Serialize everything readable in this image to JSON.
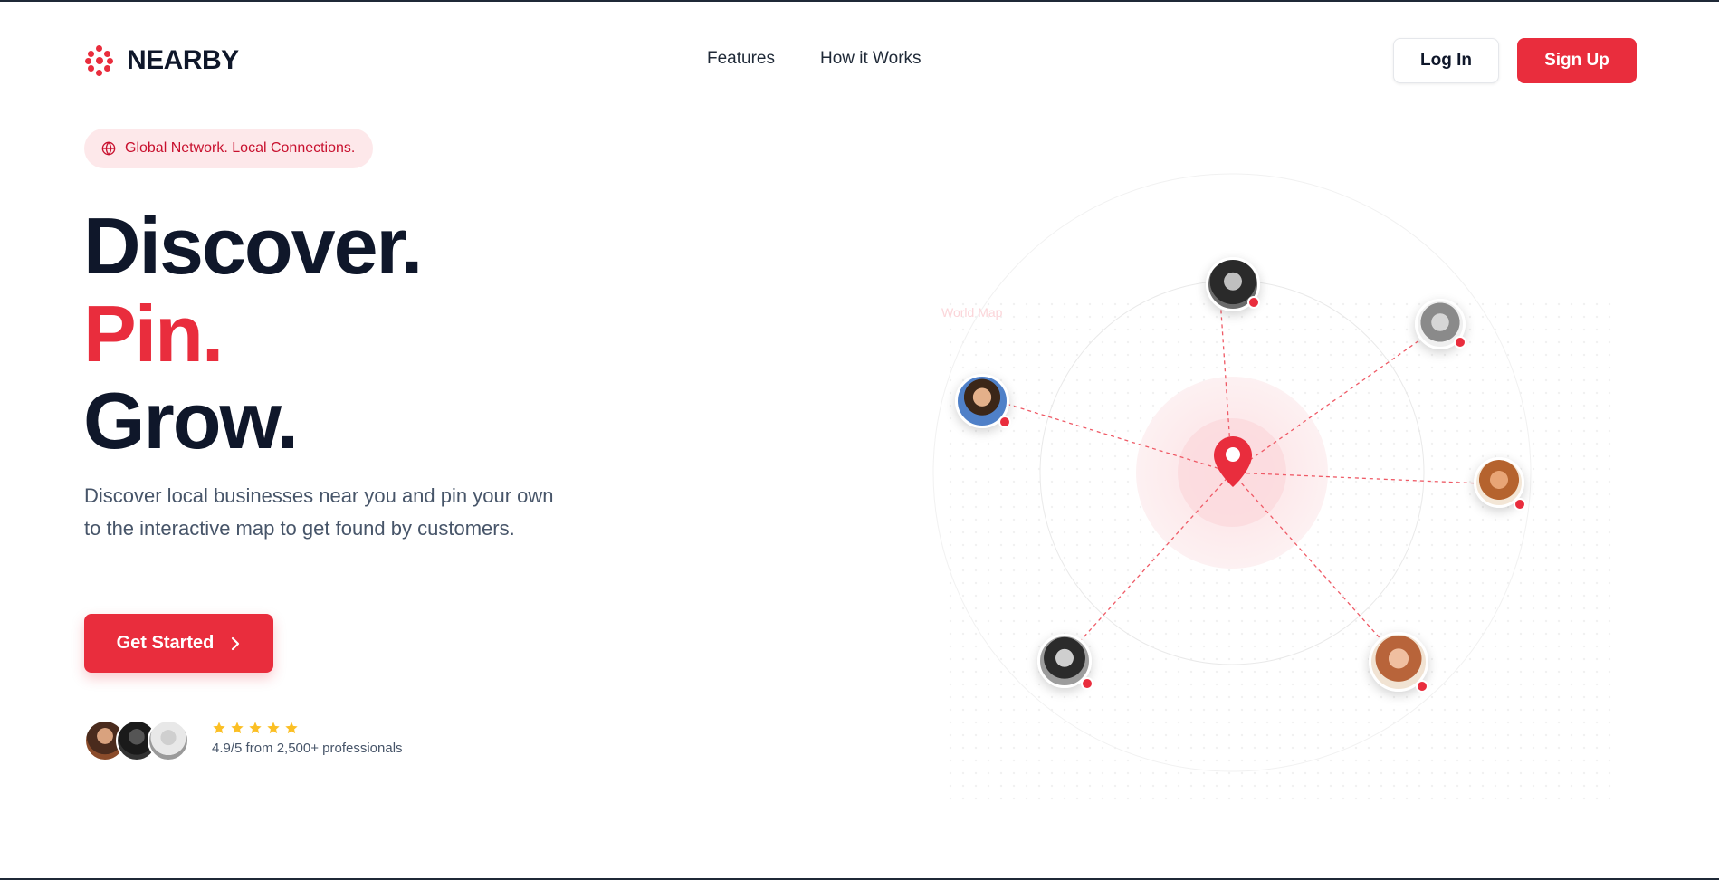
{
  "brand": {
    "name": "NEARBY",
    "accent": "#e92d3d"
  },
  "nav": {
    "links": [
      "Features",
      "How it Works"
    ],
    "login_label": "Log In",
    "signup_label": "Sign Up"
  },
  "hero": {
    "badge": "Global Network. Local Connections.",
    "headline": [
      "Discover.",
      "Pin.",
      "Grow."
    ],
    "description": "Discover local businesses near you and pin your own to the interactive map to get found by customers.",
    "cta_label": "Get Started",
    "rating_text": "4.9/5 from 2,500+ professionals",
    "stars": 5
  },
  "map": {
    "alt_text": "World Map"
  },
  "icons": {
    "logo": "dots-cluster-icon",
    "badge": "globe-icon",
    "cta": "chevron-right-icon",
    "star": "star-icon",
    "pin": "location-pin-icon"
  }
}
